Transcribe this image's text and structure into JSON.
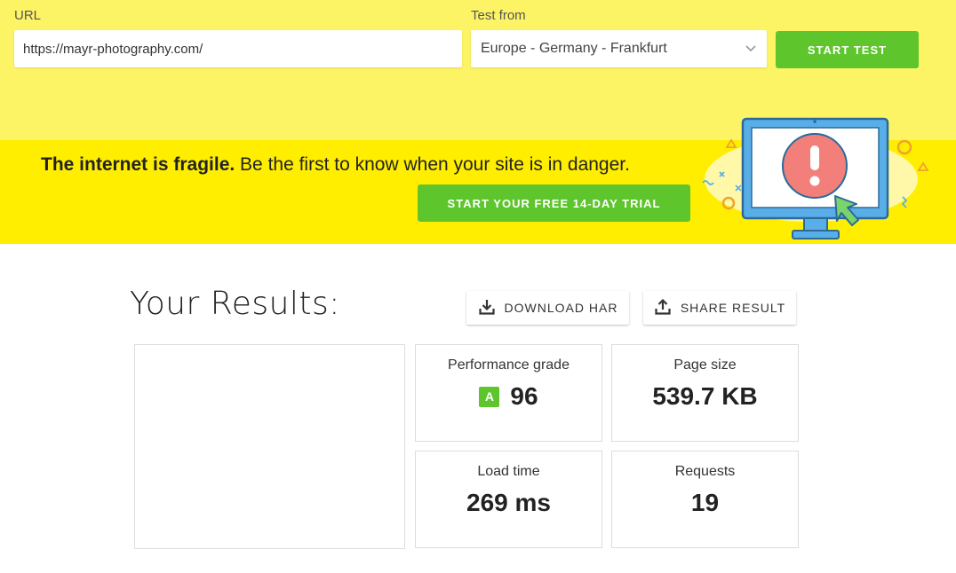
{
  "form": {
    "url_label": "URL",
    "url_value": "https://mayr-photography.com/",
    "test_from_label": "Test from",
    "test_from_value": "Europe - Germany - Frankfurt",
    "start_test_label": "START TEST"
  },
  "banner": {
    "headline_bold": "The internet is fragile.",
    "headline_rest": " Be the first to know when your site is in danger.",
    "trial_label": "START YOUR FREE 14-DAY TRIAL"
  },
  "results": {
    "title": "Your Results:",
    "download_label": "DOWNLOAD HAR",
    "share_label": "SHARE RESULT",
    "performance": {
      "label": "Performance grade",
      "grade": "A",
      "value": "96"
    },
    "page_size": {
      "label": "Page size",
      "value": "539.7 KB"
    },
    "load_time": {
      "label": "Load time",
      "value": "269 ms"
    },
    "requests": {
      "label": "Requests",
      "value": "19"
    }
  },
  "icons": {
    "select": "chevron-down-icon",
    "download": "download-icon",
    "share": "share-icon",
    "banner": "monitor-alert-icon"
  },
  "colors": {
    "top_bg": "#fdf465",
    "banner_bg": "#ffee00",
    "button_green": "#5ec52d",
    "grade_green": "#5ec52d"
  }
}
